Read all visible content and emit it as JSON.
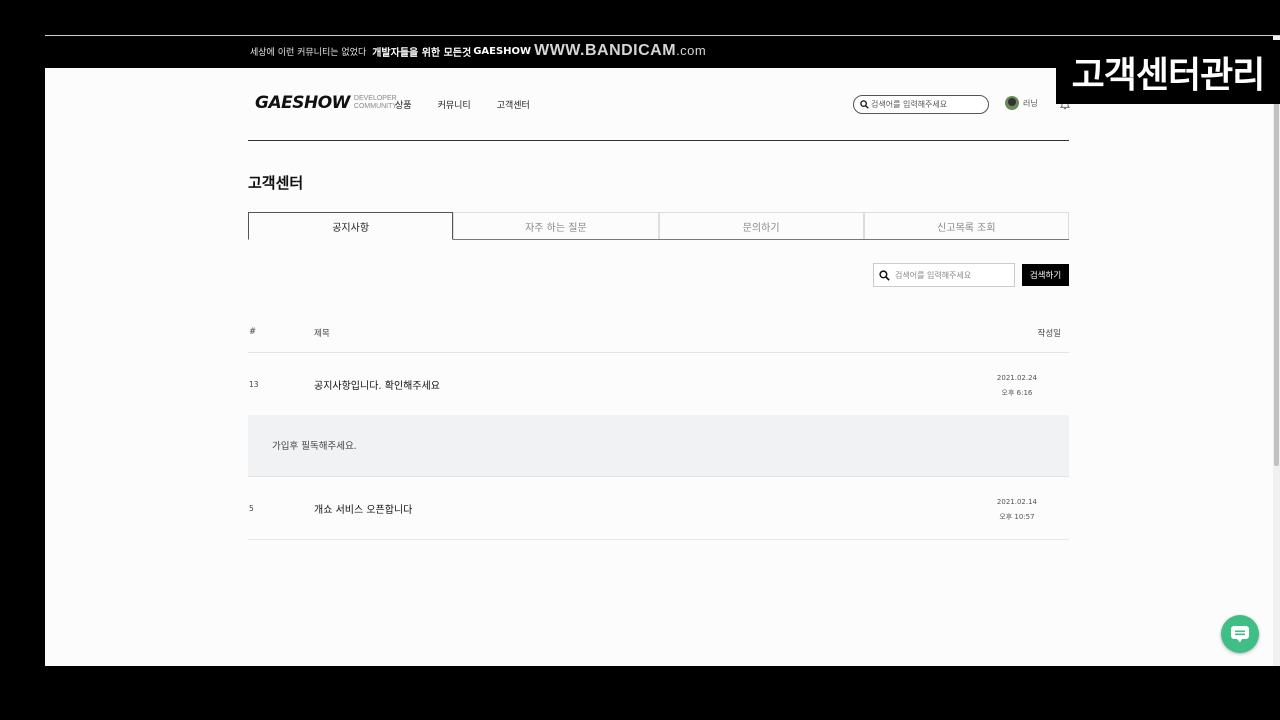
{
  "banner": {
    "text1": "세상에 이런 커뮤니티는 없었다",
    "text2": "개발자들을 위한 모든것",
    "text3": "GAESHOW",
    "watermark": "WWW.BANDICAM",
    "watermark_suffix": ".com"
  },
  "overlay_caption": "고객센터관리",
  "header": {
    "logo": "GAESHOW",
    "logo_sub1": "DEVELOPER",
    "logo_sub2": "COMMUNITY",
    "nav": [
      "상품",
      "커뮤니티",
      "고객센터"
    ],
    "search_placeholder": "검색어를 입력해주세요",
    "username": "러닝"
  },
  "page_title": "고객센터",
  "tabs": [
    {
      "label": "공지사항",
      "active": true
    },
    {
      "label": "자주 하는 질문",
      "active": false
    },
    {
      "label": "문의하기",
      "active": false
    },
    {
      "label": "신고목록 조회",
      "active": false
    }
  ],
  "board_search": {
    "placeholder": "검색어를 입력해주세요",
    "button": "검색하기"
  },
  "table": {
    "headers": {
      "num": "#",
      "title": "제목",
      "date": "작성일"
    },
    "rows": [
      {
        "num": "13",
        "title": "공지사항입니다. 확인해주세요",
        "date": "2021.02.24",
        "time": "오후 6:16"
      },
      {
        "num": "5",
        "title": "개쇼 서비스 오픈합니다",
        "date": "2021.02.14",
        "time": "오후 10:57"
      }
    ],
    "expanded_content": "가입후 필독해주세요."
  },
  "colors": {
    "accent": "#000000",
    "chat": "#3fbf86",
    "detail_bg": "#f0f2f3"
  },
  "icons": {
    "search": "search-icon",
    "bell": "bell-icon",
    "chat": "chat-icon"
  }
}
